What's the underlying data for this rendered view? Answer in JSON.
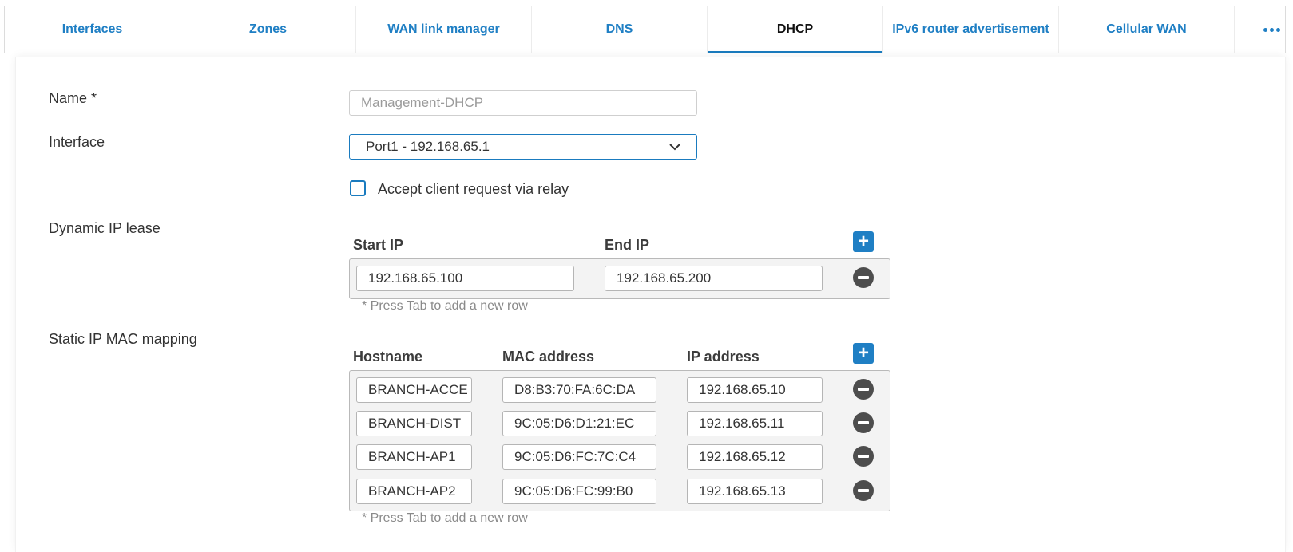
{
  "tabs": [
    {
      "label": "Interfaces",
      "active": false
    },
    {
      "label": "Zones",
      "active": false
    },
    {
      "label": "WAN link manager",
      "active": false
    },
    {
      "label": "DNS",
      "active": false
    },
    {
      "label": "DHCP",
      "active": true
    },
    {
      "label": "IPv6 router advertisement",
      "active": false
    },
    {
      "label": "Cellular WAN",
      "active": false
    }
  ],
  "more_icon": "more-horizontal-icon",
  "form": {
    "name": {
      "label": "Name *",
      "value": "Management-DHCP"
    },
    "interface": {
      "label": "Interface",
      "value": "Port1 - 192.168.65.1"
    },
    "relay": {
      "label": "Accept client request via relay",
      "checked": false
    },
    "dynamic_lease": {
      "label": "Dynamic IP lease",
      "col_start": "Start IP",
      "col_end": "End IP",
      "rows": [
        {
          "start": "192.168.65.100",
          "end": "192.168.65.200"
        }
      ],
      "hint": "* Press Tab to add a new row"
    },
    "static_mapping": {
      "label": "Static IP MAC mapping",
      "col_hostname": "Hostname",
      "col_mac": "MAC address",
      "col_ip": "IP address",
      "rows": [
        {
          "hostname": "BRANCH-ACCE",
          "mac": "D8:B3:70:FA:6C:DA",
          "ip": "192.168.65.10"
        },
        {
          "hostname": "BRANCH-DIST",
          "mac": "9C:05:D6:D1:21:EC",
          "ip": "192.168.65.11"
        },
        {
          "hostname": "BRANCH-AP1",
          "mac": "9C:05:D6:FC:7C:C4",
          "ip": "192.168.65.12"
        },
        {
          "hostname": "BRANCH-AP2",
          "mac": "9C:05:D6:FC:99:B0",
          "ip": "192.168.65.13"
        }
      ],
      "hint": "* Press Tab to add a new row"
    }
  },
  "colors": {
    "accent": "#1a7bbf",
    "link": "#1f7fc4"
  }
}
